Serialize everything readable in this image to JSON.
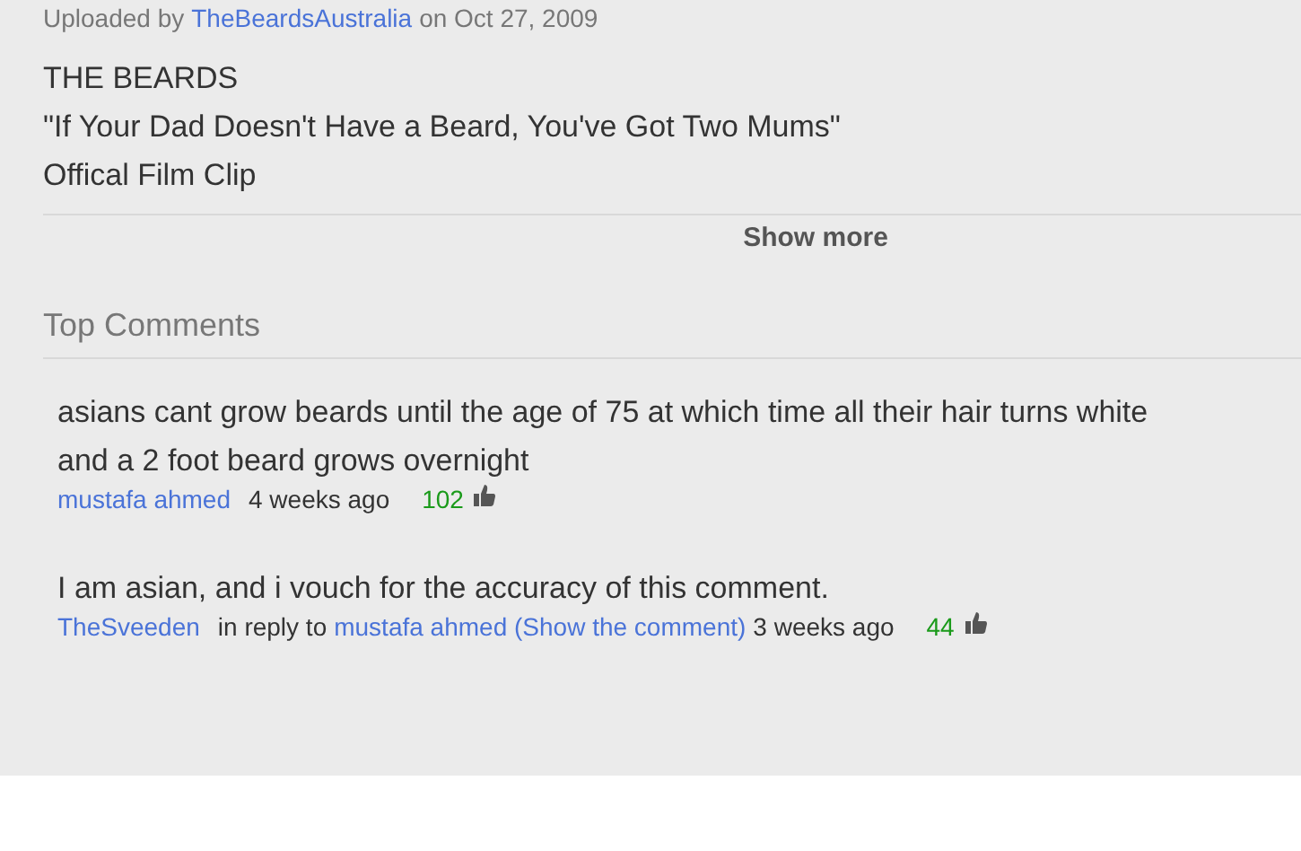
{
  "upload": {
    "prefix": "Uploaded by",
    "uploader": "TheBeardsAustralia",
    "date_text": "on Oct 27, 2009"
  },
  "description": [
    "THE BEARDS",
    "\"If Your Dad Doesn't Have a Beard, You've Got Two Mums\"",
    "Offical Film Clip"
  ],
  "show_more": "Show more",
  "comments_heading": "Top Comments",
  "comments": [
    {
      "text": "asians cant grow beards until the age of 75 at which time all their hair turns white and a 2 foot beard grows overnight",
      "author": "mustafa ahmed",
      "time": "4 weeks ago",
      "likes": "102"
    },
    {
      "text": "I am asian, and i vouch for the accuracy of this comment.",
      "author": "TheSveeden",
      "reply_prefix": "in reply to",
      "reply_link": "mustafa ahmed (Show the comment)",
      "time": "3 weeks ago",
      "likes": "44"
    }
  ]
}
